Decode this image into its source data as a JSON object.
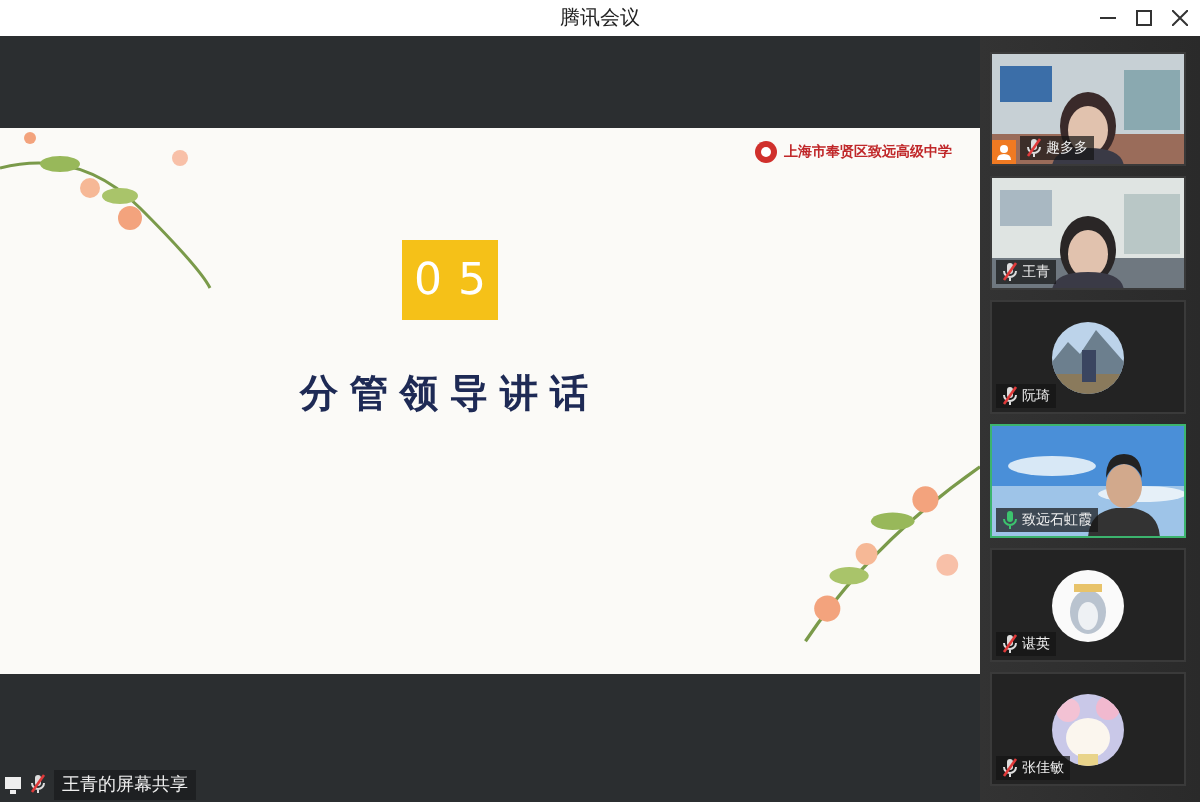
{
  "window": {
    "title": "腾讯会议"
  },
  "slide": {
    "school": "上海市奉贤区致远高级中学",
    "number": "05",
    "heading": "分管领导讲话"
  },
  "participants": [
    {
      "name": "趣多多",
      "kind": "video",
      "muted": true,
      "speaking": false,
      "host": true
    },
    {
      "name": "王青",
      "kind": "video",
      "muted": true,
      "speaking": false,
      "host": false
    },
    {
      "name": "阮琦",
      "kind": "avatar",
      "muted": true,
      "speaking": false,
      "host": false
    },
    {
      "name": "致远石虹霞",
      "kind": "video",
      "muted": false,
      "speaking": true,
      "host": false
    },
    {
      "name": "谌英",
      "kind": "avatar",
      "muted": true,
      "speaking": false,
      "host": false
    },
    {
      "name": "张佳敏",
      "kind": "avatar",
      "muted": true,
      "speaking": false,
      "host": false
    }
  ],
  "status": {
    "share_label": "王青的屏幕共享",
    "muted": true
  }
}
